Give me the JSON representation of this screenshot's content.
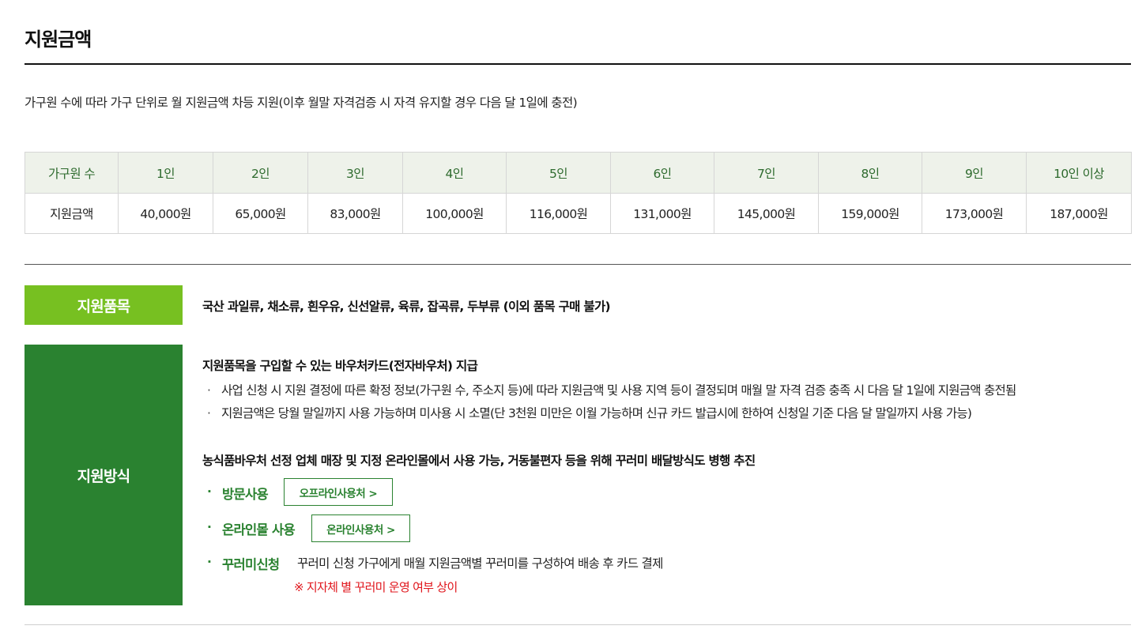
{
  "page": {
    "title": "지원금액",
    "intro": "가구원 수에 따라 가구 단위로 월 지원금액 차등 지원(이후 월말 자격검증 시 자격 유지할 경우 다음 달 1일에 충전)"
  },
  "amount_table": {
    "header_label": "가구원 수",
    "row_label": "지원금액",
    "household_sizes": [
      "1인",
      "2인",
      "3인",
      "4인",
      "5인",
      "6인",
      "7인",
      "8인",
      "9인",
      "10인 이상"
    ],
    "amounts": [
      "40,000원",
      "65,000원",
      "83,000원",
      "100,000원",
      "116,000원",
      "131,000원",
      "145,000원",
      "159,000원",
      "173,000원",
      "187,000원"
    ]
  },
  "items": {
    "label": "지원품목",
    "text": "국산 과일류, 채소류, 흰우유, 신선알류, 육류, 잡곡류, 두부류 (이외 품목 구매 불가)"
  },
  "method": {
    "label": "지원방식",
    "heading1": "지원품목을 구입할 수 있는 바우처카드(전자바우처) 지급",
    "bullets": [
      "사업 신청 시 지원 결정에 따른 확정 정보(가구원 수, 주소지 등)에 따라 지원금액 및 사용 지역 등이 결정되며 매월 말 자격 검증 충족 시 다음 달 1일에 지원금액 충전됨",
      "지원금액은 당월 말일까지 사용 가능하며 미사용 시 소멸(단 3천원 미만은 이월 가능하며 신규 카드 발급시에 한하여 신청일 기준 다음 달 말일까지 사용 가능)"
    ],
    "heading2": "농식품바우처 선정 업체 매장 및 지정 온라인몰에서 사용 가능, 거동불편자 등을 위해 꾸러미 배달방식도 병행 추진",
    "bullet_mark": "·",
    "visit": {
      "label": "방문사용",
      "button": "오프라인사용처 >"
    },
    "online": {
      "label": "온라인몰 사용",
      "button": "온라인사용처 >"
    },
    "package": {
      "label": "꾸러미신청",
      "desc": "꾸러미 신청 가구에게 매월 지원금액별 꾸러미를 구성하여 배송 후 카드 결제",
      "note": "※ 지자체 별 꾸러미 운영 여부 상이"
    }
  },
  "colors": {
    "accent_dark_green": "#2a8230",
    "accent_light_green": "#77c021",
    "table_header_bg": "#eef2ea",
    "note_red": "#e0161c"
  }
}
